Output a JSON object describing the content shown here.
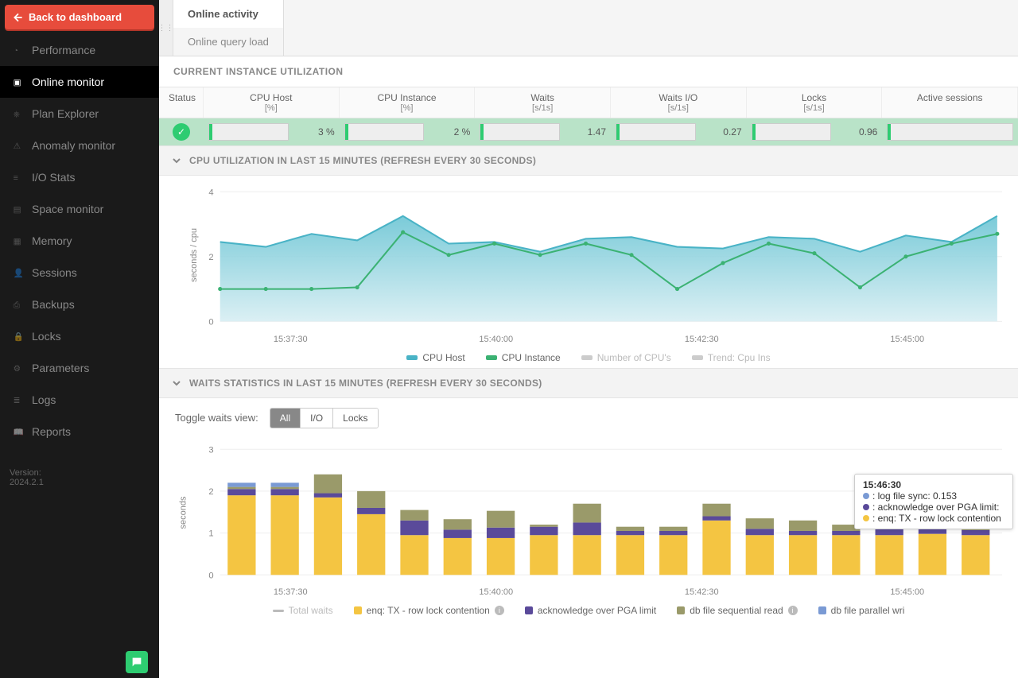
{
  "sidebar": {
    "back_label": "Back to dashboard",
    "items": [
      {
        "label": "Performance"
      },
      {
        "label": "Online monitor"
      },
      {
        "label": "Plan Explorer"
      },
      {
        "label": "Anomaly monitor"
      },
      {
        "label": "I/O Stats"
      },
      {
        "label": "Space monitor"
      },
      {
        "label": "Memory"
      },
      {
        "label": "Sessions"
      },
      {
        "label": "Backups"
      },
      {
        "label": "Locks"
      },
      {
        "label": "Parameters"
      },
      {
        "label": "Logs"
      },
      {
        "label": "Reports"
      }
    ],
    "active_index": 1,
    "version_label": "Version:",
    "version_value": "2024.2.1"
  },
  "tabs": {
    "items": [
      {
        "label": "Online activity"
      },
      {
        "label": "Online query load"
      }
    ],
    "active_index": 0
  },
  "current_util": {
    "title": "CURRENT INSTANCE UTILIZATION",
    "headers": [
      {
        "label": "Status",
        "sub": ""
      },
      {
        "label": "CPU Host",
        "sub": "[%]"
      },
      {
        "label": "CPU Instance",
        "sub": "[%]"
      },
      {
        "label": "Waits",
        "sub": "[s/1s]"
      },
      {
        "label": "Waits I/O",
        "sub": "[s/1s]"
      },
      {
        "label": "Locks",
        "sub": "[s/1s]"
      },
      {
        "label": "Active sessions",
        "sub": ""
      }
    ],
    "values": {
      "cpu_host": "3 %",
      "cpu_instance": "2 %",
      "waits": "1.47",
      "waits_io": "0.27",
      "locks": "0.96"
    }
  },
  "cpu_section": {
    "title": "CPU UTILIZATION IN LAST 15 MINUTES (REFRESH EVERY 30 SECONDS)",
    "ylabel": "seconds / cpu",
    "legend": [
      {
        "label": "CPU Host",
        "color": "#49b3c6",
        "disabled": false
      },
      {
        "label": "CPU Instance",
        "color": "#3bb273",
        "disabled": false
      },
      {
        "label": "Number of CPU's",
        "color": "#ccc",
        "disabled": true
      },
      {
        "label": "Trend: Cpu Ins",
        "color": "#ccc",
        "disabled": true
      }
    ]
  },
  "waits_section": {
    "title": "WAITS STATISTICS IN LAST 15 MINUTES (REFRESH EVERY 30 SECONDS)",
    "toggle_label": "Toggle waits view:",
    "toggle_options": [
      "All",
      "I/O",
      "Locks"
    ],
    "toggle_active": 0,
    "ylabel": "seconds",
    "legend": [
      {
        "label": "Total waits",
        "color": "#bbb",
        "disabled": true,
        "shape": "line"
      },
      {
        "label": "enq: TX - row lock contention",
        "color": "#f4c542",
        "info": true
      },
      {
        "label": "acknowledge over PGA limit",
        "color": "#5a4a9a"
      },
      {
        "label": "db file sequential read",
        "color": "#9a9a6a",
        "info": true
      },
      {
        "label": "db file parallel wri",
        "color": "#7a9ad4"
      }
    ]
  },
  "xticks": [
    "15:37:30",
    "15:40:00",
    "15:42:30",
    "15:45:00"
  ],
  "tooltip": {
    "time": "15:46:30",
    "rows": [
      {
        "color": "#7a9ad4",
        "text": ": log file sync: 0.153"
      },
      {
        "color": "#5a4a9a",
        "text": ": acknowledge over PGA limit:"
      },
      {
        "color": "#f4c542",
        "text": ": enq: TX - row lock contention"
      }
    ]
  },
  "chart_data": [
    {
      "type": "area",
      "title": "CPU utilization in last 15 minutes",
      "ylabel": "seconds / cpu",
      "ylim": [
        0,
        4
      ],
      "yticks": [
        0,
        2,
        4
      ],
      "x": [
        "15:37:30",
        "15:38:00",
        "15:38:30",
        "15:39:00",
        "15:39:30",
        "15:40:00",
        "15:40:30",
        "15:41:00",
        "15:41:30",
        "15:42:00",
        "15:42:30",
        "15:43:00",
        "15:43:30",
        "15:44:00",
        "15:44:30",
        "15:45:00",
        "15:45:30",
        "15:46:00"
      ],
      "series": [
        {
          "name": "CPU Host",
          "color": "#49b3c6",
          "values": [
            2.45,
            2.3,
            2.7,
            2.5,
            3.25,
            2.4,
            2.45,
            2.15,
            2.55,
            2.6,
            2.3,
            2.25,
            2.6,
            2.55,
            2.15,
            2.65,
            2.45,
            3.25
          ]
        },
        {
          "name": "CPU Instance",
          "color": "#3bb273",
          "values": [
            1.0,
            1.0,
            1.0,
            1.05,
            2.75,
            2.05,
            2.4,
            2.05,
            2.4,
            2.05,
            1.0,
            1.8,
            2.4,
            2.1,
            1.05,
            2.0,
            2.4,
            2.7
          ]
        }
      ]
    },
    {
      "type": "bar",
      "title": "Waits statistics in last 15 minutes",
      "ylabel": "seconds",
      "ylim": [
        0,
        3
      ],
      "yticks": [
        0,
        1,
        2,
        3
      ],
      "categories": [
        "15:37:30",
        "15:38:00",
        "15:38:30",
        "15:39:00",
        "15:39:30",
        "15:40:00",
        "15:40:30",
        "15:41:00",
        "15:41:30",
        "15:42:00",
        "15:42:30",
        "15:43:00",
        "15:43:30",
        "15:44:00",
        "15:44:30",
        "15:45:00",
        "15:45:30",
        "15:46:00"
      ],
      "stacked": true,
      "series": [
        {
          "name": "enq: TX - row lock contention",
          "color": "#f4c542",
          "values": [
            1.9,
            1.9,
            1.85,
            1.45,
            0.95,
            0.88,
            0.88,
            0.95,
            0.95,
            0.95,
            0.95,
            1.3,
            0.95,
            0.95,
            0.95,
            0.95,
            0.98,
            0.95
          ]
        },
        {
          "name": "acknowledge over PGA limit",
          "color": "#5a4a9a",
          "values": [
            0.15,
            0.15,
            0.1,
            0.15,
            0.35,
            0.2,
            0.25,
            0.2,
            0.3,
            0.1,
            0.1,
            0.1,
            0.15,
            0.1,
            0.1,
            0.35,
            0.3,
            0.12
          ]
        },
        {
          "name": "db file sequential read",
          "color": "#9a9a6a",
          "values": [
            0.05,
            0.05,
            0.45,
            0.4,
            0.25,
            0.25,
            0.4,
            0.05,
            0.45,
            0.1,
            0.1,
            0.3,
            0.25,
            0.25,
            0.15,
            0.3,
            0.35,
            0.3
          ]
        },
        {
          "name": "db file parallel write",
          "color": "#7a9ad4",
          "values": [
            0.1,
            0.1,
            0.0,
            0.0,
            0.0,
            0.0,
            0.0,
            0.0,
            0.0,
            0.0,
            0.0,
            0.0,
            0.0,
            0.0,
            0.0,
            0.0,
            0.0,
            0.0
          ]
        }
      ]
    }
  ]
}
